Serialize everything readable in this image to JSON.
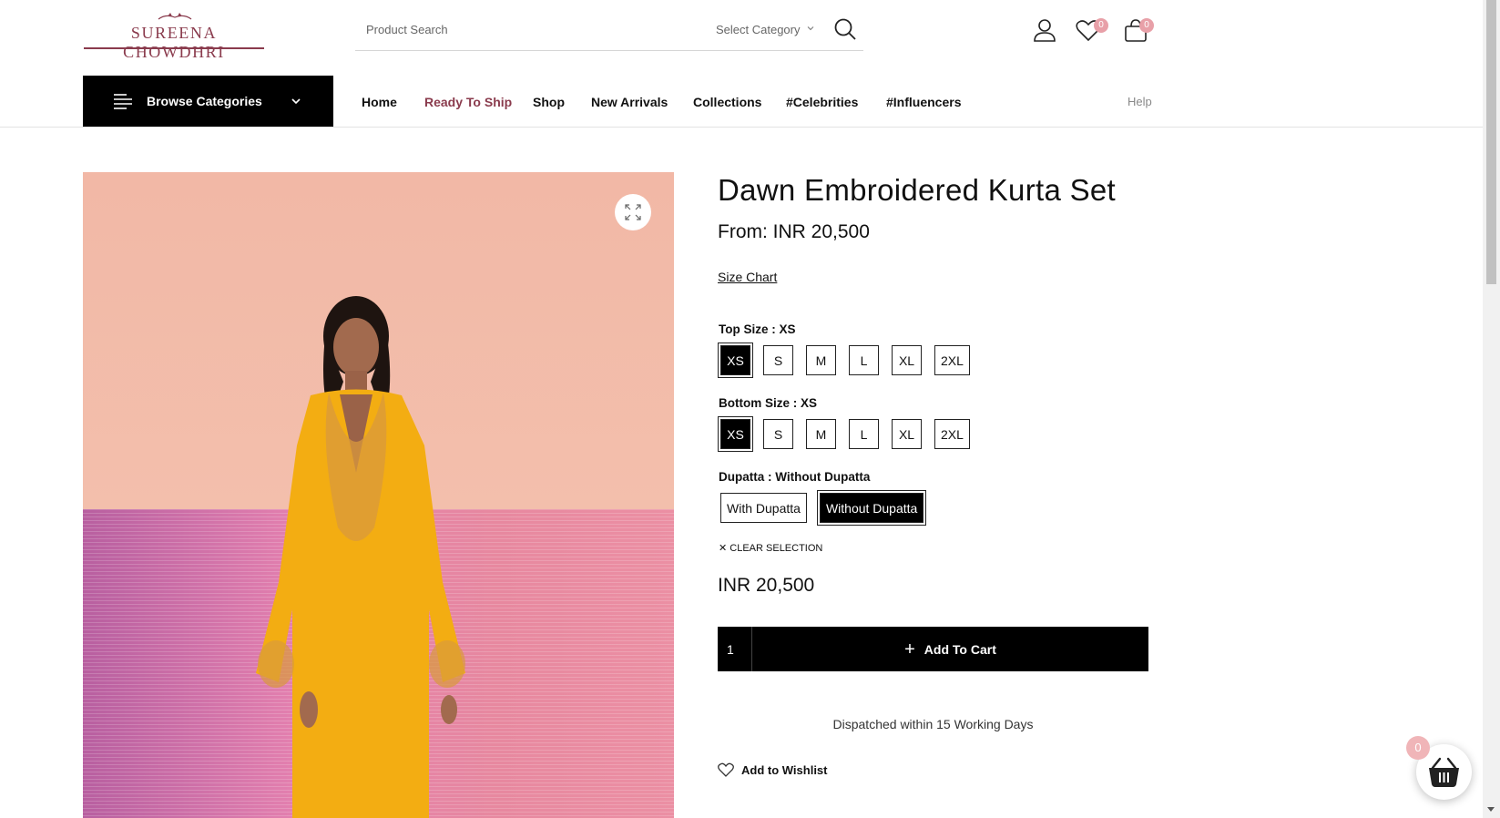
{
  "header": {
    "logo_text": "SUREENA CHOWDHRI",
    "search": {
      "placeholder": "Product Search",
      "category_label": "Select Category"
    },
    "wishlist_count": "0",
    "cart_count": "0"
  },
  "nav": {
    "browse_label": "Browse Categories",
    "items": [
      {
        "label": "Home"
      },
      {
        "label": "Ready To Ship"
      },
      {
        "label": "Shop"
      },
      {
        "label": "New Arrivals"
      },
      {
        "label": "Collections"
      },
      {
        "label": "#Celebrities"
      },
      {
        "label": "#Influencers"
      }
    ],
    "help_label": "Help"
  },
  "product": {
    "title": "Dawn Embroidered Kurta Set",
    "from_price": "From: INR 20,500",
    "size_chart_label": "Size Chart",
    "top_size": {
      "label": "Top Size : XS",
      "options": [
        "XS",
        "S",
        "M",
        "L",
        "XL",
        "2XL"
      ],
      "selected": "XS"
    },
    "bottom_size": {
      "label": "Bottom Size : XS",
      "options": [
        "XS",
        "S",
        "M",
        "L",
        "XL",
        "2XL"
      ],
      "selected": "XS"
    },
    "dupatta": {
      "label": "Dupatta : Without Dupatta",
      "options": [
        "With Dupatta",
        "Without Dupatta"
      ],
      "selected": "Without Dupatta"
    },
    "clear_label": "CLEAR SELECTION",
    "price": "INR 20,500",
    "quantity": "1",
    "add_to_cart_label": "Add To Cart",
    "dispatch_text": "Dispatched within 15 Working Days",
    "wishlist_label": "Add to Wishlist"
  },
  "floating_cart": {
    "count": "0"
  },
  "colors": {
    "brand": "#8a3b4d",
    "badge": "#e8a0a8",
    "primary_button": "#000000"
  }
}
